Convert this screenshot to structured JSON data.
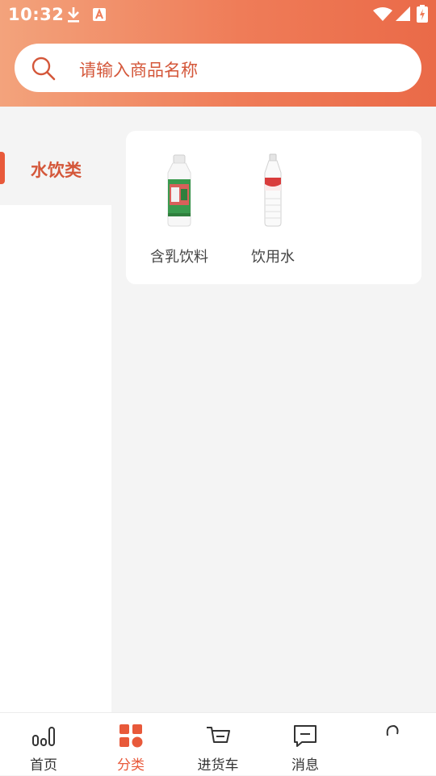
{
  "status_bar": {
    "time": "10:32"
  },
  "search": {
    "placeholder": "请输入商品名称"
  },
  "sidebar": {
    "items": [
      {
        "label": "水饮类",
        "active": true
      }
    ]
  },
  "products": [
    {
      "name": "含乳饮料",
      "icon": "milk-bottle"
    },
    {
      "name": "饮用水",
      "icon": "water-bottle"
    }
  ],
  "tabbar": {
    "tabs": [
      {
        "label": "首页",
        "icon": "home-bars-icon"
      },
      {
        "label": "分类",
        "icon": "category-grid-icon",
        "active": true
      },
      {
        "label": "进货车",
        "icon": "cart-icon"
      },
      {
        "label": "消息",
        "icon": "message-icon"
      },
      {
        "label": "",
        "icon": "profile-icon"
      }
    ]
  },
  "colors": {
    "accent": "#e8593a",
    "header_start": "#f3a37c",
    "header_end": "#ea6a48"
  }
}
